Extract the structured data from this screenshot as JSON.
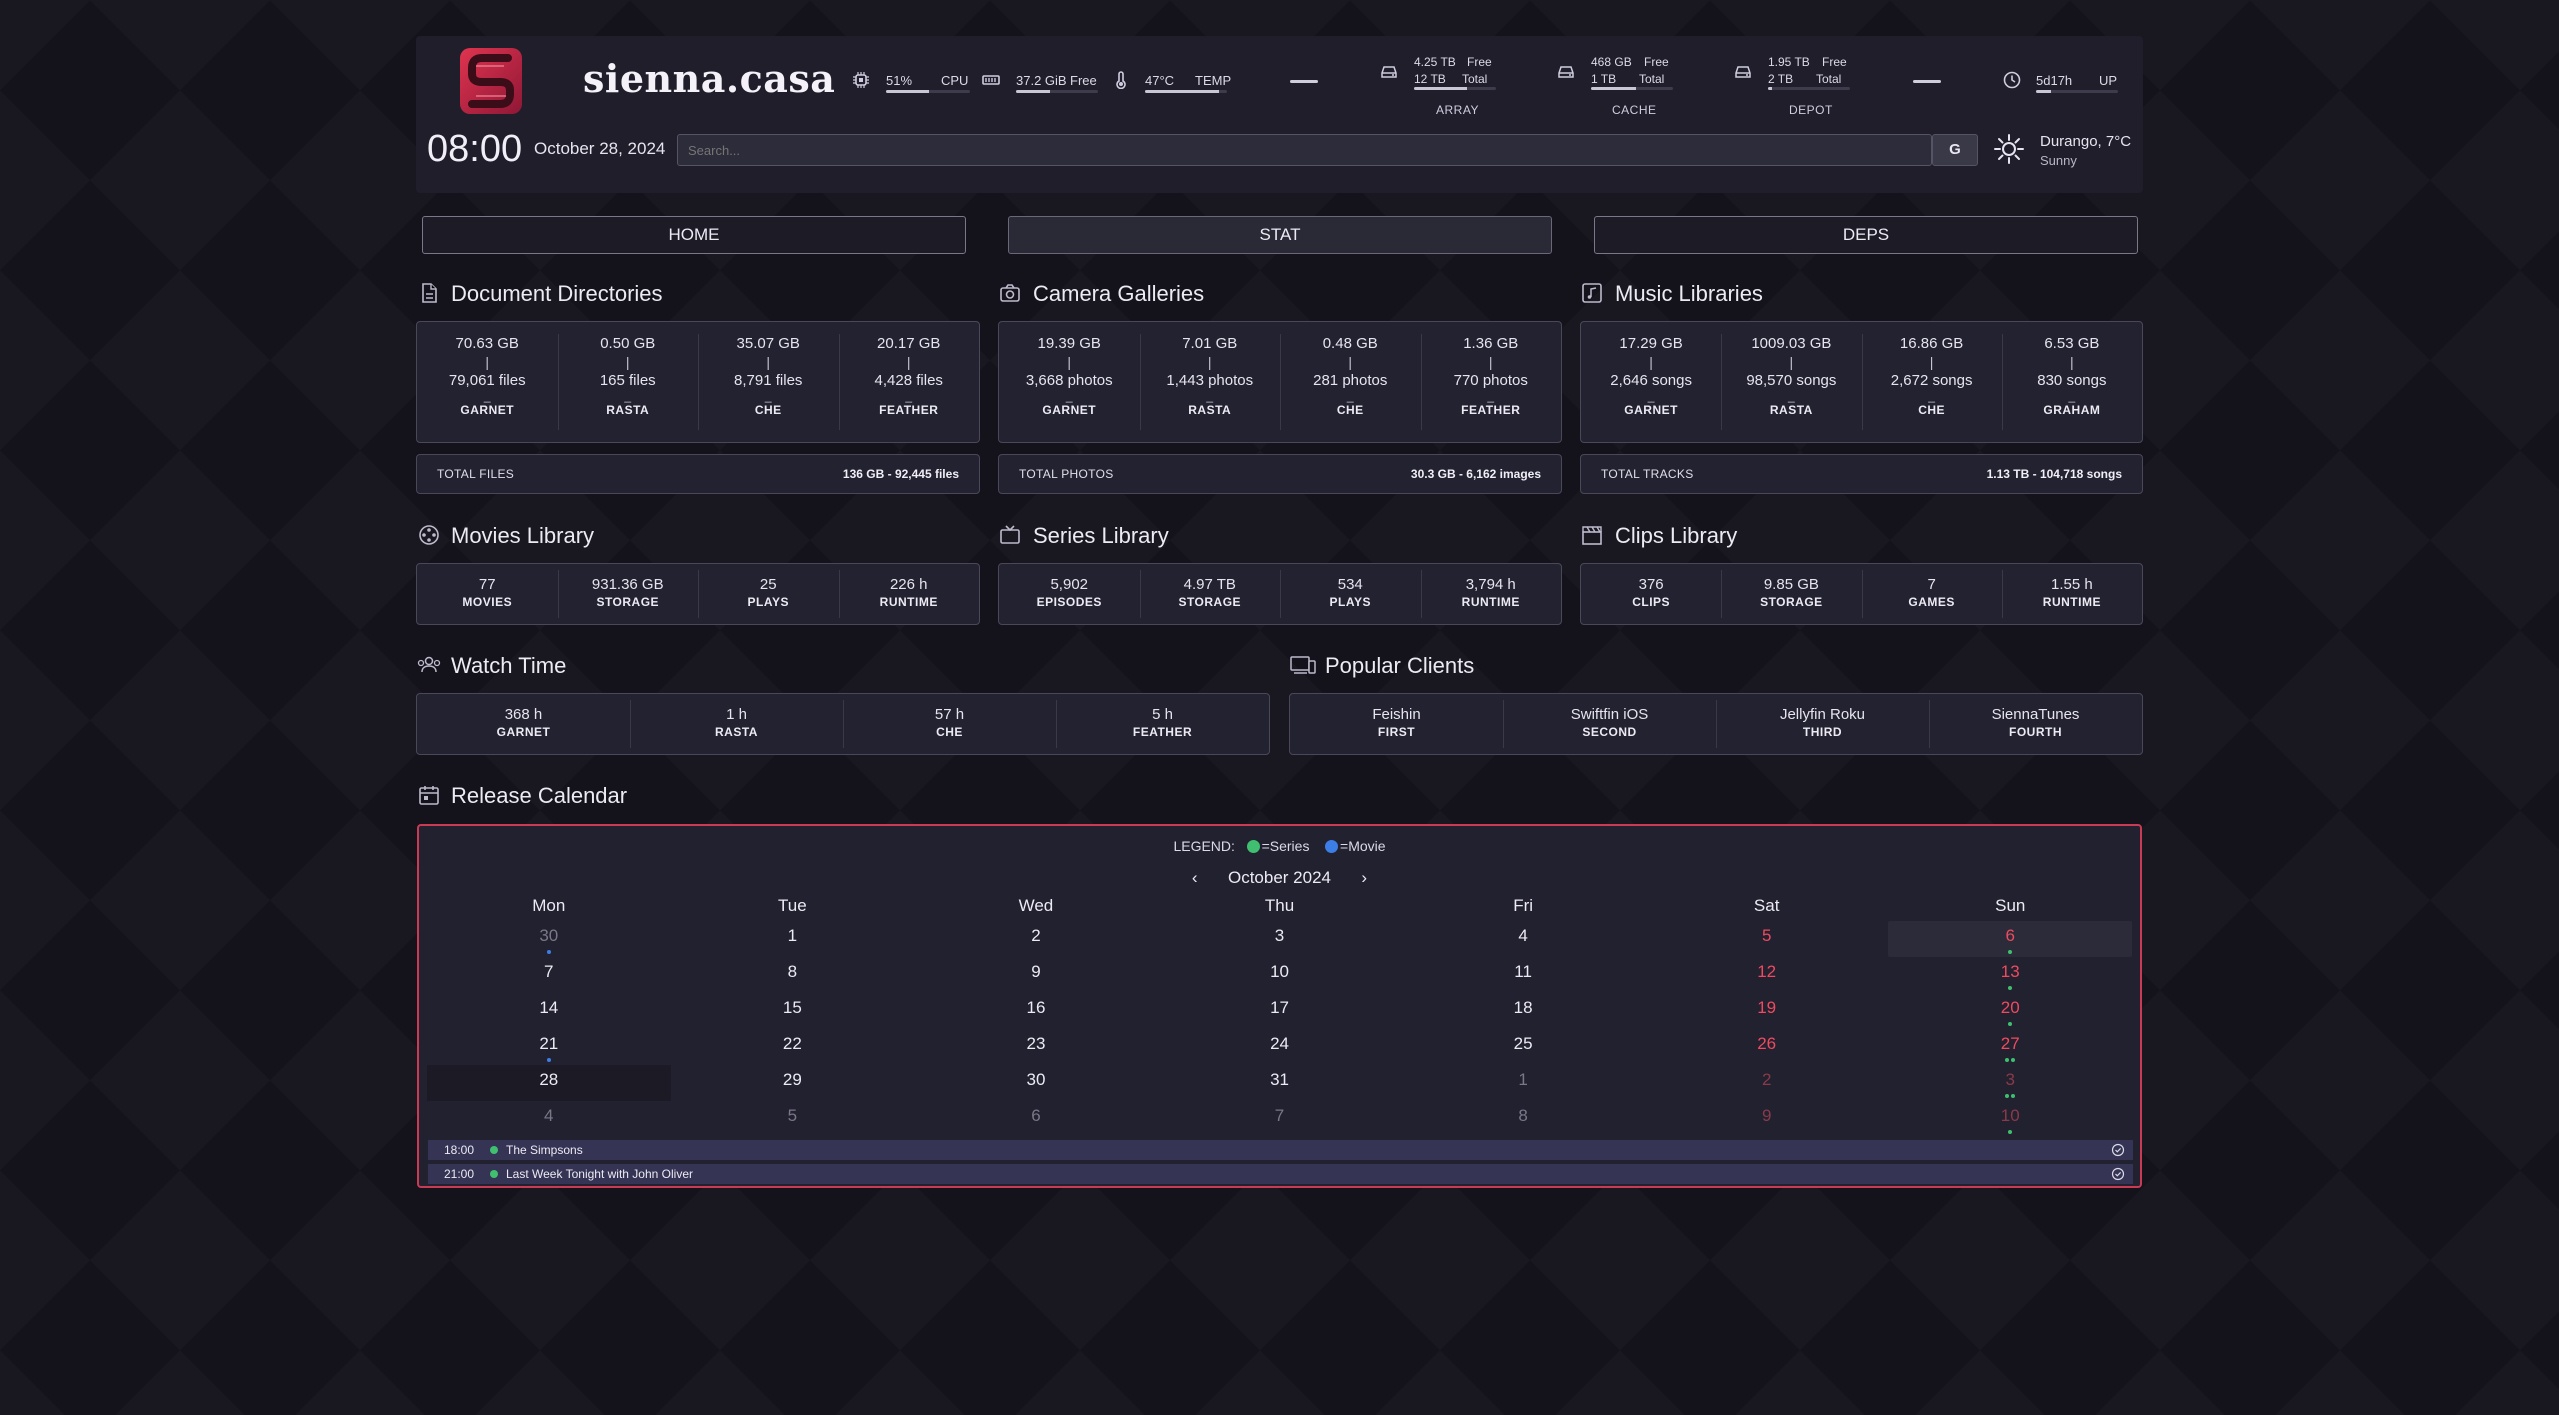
{
  "colors": {
    "series": "#3fbf6f",
    "movie": "#3d7ee6",
    "accent": "#c93a55",
    "weekend": "#ef4a5f"
  },
  "header": {
    "site_title": "sienna.casa",
    "cpu": {
      "value": "51%",
      "label": "CPU",
      "fill": 0.51
    },
    "ram": {
      "value": "37.2 GiB",
      "label": "Free",
      "fill": 0.42
    },
    "temp": {
      "value": "47°C",
      "label": "TEMP",
      "fill": 0.9
    },
    "disks": [
      {
        "free": "4.25 TB",
        "free_label": "Free",
        "total": "12 TB",
        "total_label": "Total",
        "name": "ARRAY",
        "fill": 0.65
      },
      {
        "free": "468 GB",
        "free_label": "Free",
        "total": "1 TB",
        "total_label": "Total",
        "name": "CACHE",
        "fill": 0.55
      },
      {
        "free": "1.95 TB",
        "free_label": "Free",
        "total": "2 TB",
        "total_label": "Total",
        "name": "DEPOT",
        "fill": 0.05
      }
    ],
    "uptime": {
      "value": "5d17h",
      "label": "UP",
      "fill": 0.18
    },
    "clock": "08:00",
    "date": "October 28, 2024",
    "search_placeholder": "Search...",
    "search_button": "G",
    "weather": {
      "location": "Durango, 7°C",
      "condition": "Sunny",
      "icon": "sun-icon"
    }
  },
  "nav": {
    "home": "HOME",
    "stat": "STAT",
    "deps": "DEPS"
  },
  "documents": {
    "title": "Document Directories",
    "icon": "document-icon",
    "cells": [
      {
        "size": "70.63 GB",
        "count": "79,061 files",
        "name": "GARNET"
      },
      {
        "size": "0.50 GB",
        "count": "165 files",
        "name": "RASTA"
      },
      {
        "size": "35.07 GB",
        "count": "8,791 files",
        "name": "CHE"
      },
      {
        "size": "20.17 GB",
        "count": "4,428 files",
        "name": "FEATHER"
      }
    ],
    "total_label": "TOTAL FILES",
    "total_value": "136 GB  - 92,445 files"
  },
  "camera": {
    "title": "Camera Galleries",
    "icon": "camera-icon",
    "cells": [
      {
        "size": "19.39 GB",
        "count": "3,668 photos",
        "name": "GARNET"
      },
      {
        "size": "7.01 GB",
        "count": "1,443 photos",
        "name": "RASTA"
      },
      {
        "size": "0.48 GB",
        "count": "281 photos",
        "name": "CHE"
      },
      {
        "size": "1.36 GB",
        "count": "770 photos",
        "name": "FEATHER"
      }
    ],
    "total_label": "TOTAL PHOTOS",
    "total_value": "30.3 GB  - 6,162 images"
  },
  "music": {
    "title": "Music Libraries",
    "icon": "music-icon",
    "cells": [
      {
        "size": "17.29 GB",
        "count": "2,646 songs",
        "name": "GARNET"
      },
      {
        "size": "1009.03 GB",
        "count": "98,570 songs",
        "name": "RASTA"
      },
      {
        "size": "16.86 GB",
        "count": "2,672 songs",
        "name": "CHE"
      },
      {
        "size": "6.53 GB",
        "count": "830 songs",
        "name": "GRAHAM"
      }
    ],
    "total_label": "TOTAL TRACKS",
    "total_value": "1.13 TB  - 104,718 songs"
  },
  "movies": {
    "title": "Movies Library",
    "icon": "film-reel-icon",
    "cells": [
      {
        "value": "77",
        "label": "MOVIES"
      },
      {
        "value": "931.36 GB",
        "label": "STORAGE"
      },
      {
        "value": "25",
        "label": "PLAYS"
      },
      {
        "value": "226 h",
        "label": "RUNTIME"
      }
    ]
  },
  "series": {
    "title": "Series Library",
    "icon": "tv-icon",
    "cells": [
      {
        "value": "5,902",
        "label": "EPISODES"
      },
      {
        "value": "4.97 TB",
        "label": "STORAGE"
      },
      {
        "value": "534",
        "label": "PLAYS"
      },
      {
        "value": "3,794 h",
        "label": "RUNTIME"
      }
    ]
  },
  "clips": {
    "title": "Clips Library",
    "icon": "clapperboard-icon",
    "cells": [
      {
        "value": "376",
        "label": "CLIPS"
      },
      {
        "value": "9.85 GB",
        "label": "STORAGE"
      },
      {
        "value": "7",
        "label": "GAMES"
      },
      {
        "value": "1.55 h",
        "label": "RUNTIME"
      }
    ]
  },
  "watch_time": {
    "title": "Watch Time",
    "icon": "users-icon",
    "cells": [
      {
        "value": "368 h",
        "label": "GARNET"
      },
      {
        "value": "1 h",
        "label": "RASTA"
      },
      {
        "value": "57 h",
        "label": "CHE"
      },
      {
        "value": "5 h",
        "label": "FEATHER"
      }
    ]
  },
  "clients": {
    "title": "Popular Clients",
    "icon": "devices-icon",
    "cells": [
      {
        "value": "Feishin",
        "label": "FIRST"
      },
      {
        "value": "Swiftfin iOS",
        "label": "SECOND"
      },
      {
        "value": "Jellyfin Roku",
        "label": "THIRD"
      },
      {
        "value": "SiennaTunes",
        "label": "FOURTH"
      }
    ]
  },
  "calendar": {
    "title": "Release Calendar",
    "icon": "calendar-icon",
    "legend_label": "LEGEND:",
    "legend_series": "=Series",
    "legend_movie": "=Movie",
    "month": "October 2024",
    "prev": "‹",
    "next": "›",
    "weekdays": [
      "Mon",
      "Tue",
      "Wed",
      "Thu",
      "Fri",
      "Sat",
      "Sun"
    ],
    "weeks": [
      [
        {
          "d": "30",
          "o": true,
          "dots": [
            "movie"
          ]
        },
        {
          "d": "1"
        },
        {
          "d": "2"
        },
        {
          "d": "3"
        },
        {
          "d": "4"
        },
        {
          "d": "5",
          "w": true
        },
        {
          "d": "6",
          "w": true,
          "today": true,
          "dots": [
            "series"
          ]
        }
      ],
      [
        {
          "d": "7"
        },
        {
          "d": "8"
        },
        {
          "d": "9"
        },
        {
          "d": "10"
        },
        {
          "d": "11"
        },
        {
          "d": "12",
          "w": true
        },
        {
          "d": "13",
          "w": true,
          "dots": [
            "series"
          ]
        }
      ],
      [
        {
          "d": "14"
        },
        {
          "d": "15"
        },
        {
          "d": "16"
        },
        {
          "d": "17"
        },
        {
          "d": "18"
        },
        {
          "d": "19",
          "w": true
        },
        {
          "d": "20",
          "w": true,
          "dots": [
            "series"
          ]
        }
      ],
      [
        {
          "d": "21",
          "dots": [
            "movie"
          ]
        },
        {
          "d": "22"
        },
        {
          "d": "23"
        },
        {
          "d": "24"
        },
        {
          "d": "25"
        },
        {
          "d": "26",
          "w": true
        },
        {
          "d": "27",
          "w": true,
          "dots": [
            "series",
            "series"
          ]
        }
      ],
      [
        {
          "d": "28",
          "selected": true
        },
        {
          "d": "29"
        },
        {
          "d": "30"
        },
        {
          "d": "31"
        },
        {
          "d": "1",
          "o": true
        },
        {
          "d": "2",
          "o": true,
          "w": true
        },
        {
          "d": "3",
          "o": true,
          "w": true,
          "dots": [
            "series",
            "series"
          ]
        }
      ],
      [
        {
          "d": "4",
          "o": true
        },
        {
          "d": "5",
          "o": true
        },
        {
          "d": "6",
          "o": true
        },
        {
          "d": "7",
          "o": true
        },
        {
          "d": "8",
          "o": true
        },
        {
          "d": "9",
          "o": true,
          "w": true
        },
        {
          "d": "10",
          "o": true,
          "w": true,
          "dots": [
            "series"
          ]
        }
      ]
    ],
    "events": [
      {
        "time": "18:00",
        "title": "The Simpsons",
        "type": "series"
      },
      {
        "time": "21:00",
        "title": "Last Week Tonight with John Oliver",
        "type": "series"
      }
    ]
  }
}
